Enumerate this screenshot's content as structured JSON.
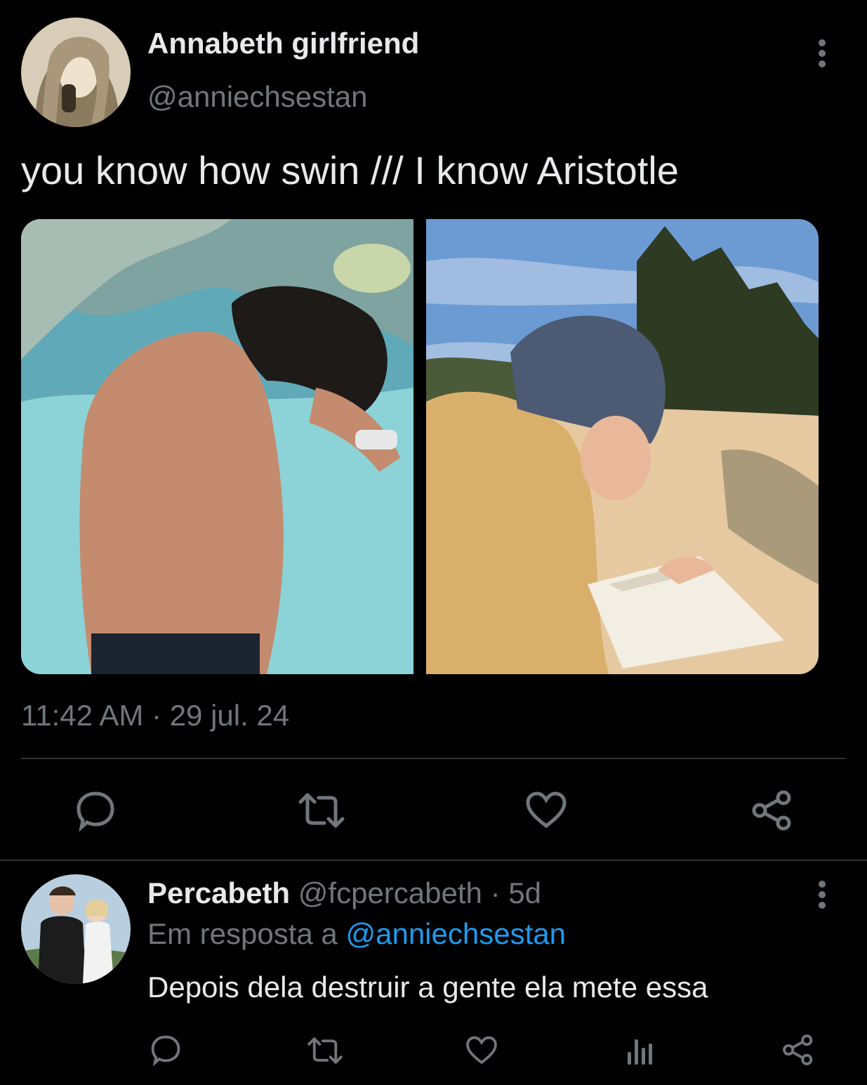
{
  "tweet": {
    "display_name": "Annabeth girlfriend",
    "handle": "@anniechsestan",
    "text": "you know how swin /// I know Aristotle",
    "time": "11:42 AM",
    "separator": "·",
    "date": "29 jul. 24",
    "avatar_icon": "avatar-photo",
    "more_icon": "more-vertical-icon",
    "media": [
      {
        "name": "photo-pool-swimmer"
      },
      {
        "name": "photo-beach-reading"
      }
    ],
    "actions": [
      {
        "name": "reply-button",
        "icon": "reply-icon"
      },
      {
        "name": "retweet-button",
        "icon": "retweet-icon"
      },
      {
        "name": "like-button",
        "icon": "heart-icon"
      },
      {
        "name": "share-button",
        "icon": "share-icon"
      }
    ]
  },
  "reply": {
    "display_name": "Percabeth",
    "handle": "@fcpercabeth",
    "separator": "·",
    "age": "5d",
    "replying_prefix": "Em resposta a",
    "replying_to": "@anniechsestan",
    "text": "Depois dela destruir a gente ela mete essa",
    "avatar_icon": "avatar-photo",
    "more_icon": "more-vertical-icon",
    "actions": [
      {
        "name": "reply-button",
        "icon": "reply-icon"
      },
      {
        "name": "retweet-button",
        "icon": "retweet-icon"
      },
      {
        "name": "like-button",
        "icon": "heart-icon"
      },
      {
        "name": "analytics-button",
        "icon": "bar-chart-icon"
      },
      {
        "name": "share-button",
        "icon": "share-icon"
      }
    ]
  },
  "colors": {
    "background": "#000000",
    "primary_text": "#e7e9ea",
    "secondary_text": "#71767b",
    "link": "#1d9bf0",
    "divider": "#2f3336"
  }
}
